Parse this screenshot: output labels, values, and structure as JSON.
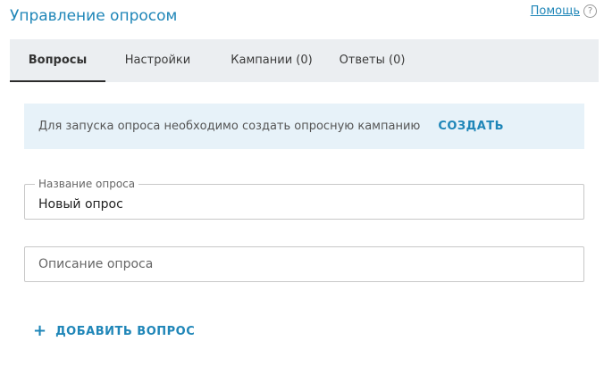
{
  "header": {
    "title": "Управление опросом",
    "help_label": "Помощь",
    "help_icon_glyph": "?"
  },
  "tabs": [
    {
      "label": "Вопросы",
      "active": true
    },
    {
      "label": "Настройки",
      "active": false
    },
    {
      "label": "Кампании (0)",
      "active": false
    },
    {
      "label": "Ответы (0)",
      "active": false
    }
  ],
  "notice": {
    "text": "Для запуска опроса необходимо создать опросную кампанию",
    "action_label": "СОЗДАТЬ"
  },
  "form": {
    "title_field": {
      "label": "Название опроса",
      "value": "Новый опрос"
    },
    "description_field": {
      "placeholder": "Описание опроса",
      "value": ""
    }
  },
  "actions": {
    "add_question_label": "ДОБАВИТЬ ВОПРОС",
    "add_icon": "plus-icon"
  },
  "colors": {
    "accent": "#1f86b8",
    "tab_bar": "#ebeef1",
    "notice_bg": "#e7f2f9"
  }
}
